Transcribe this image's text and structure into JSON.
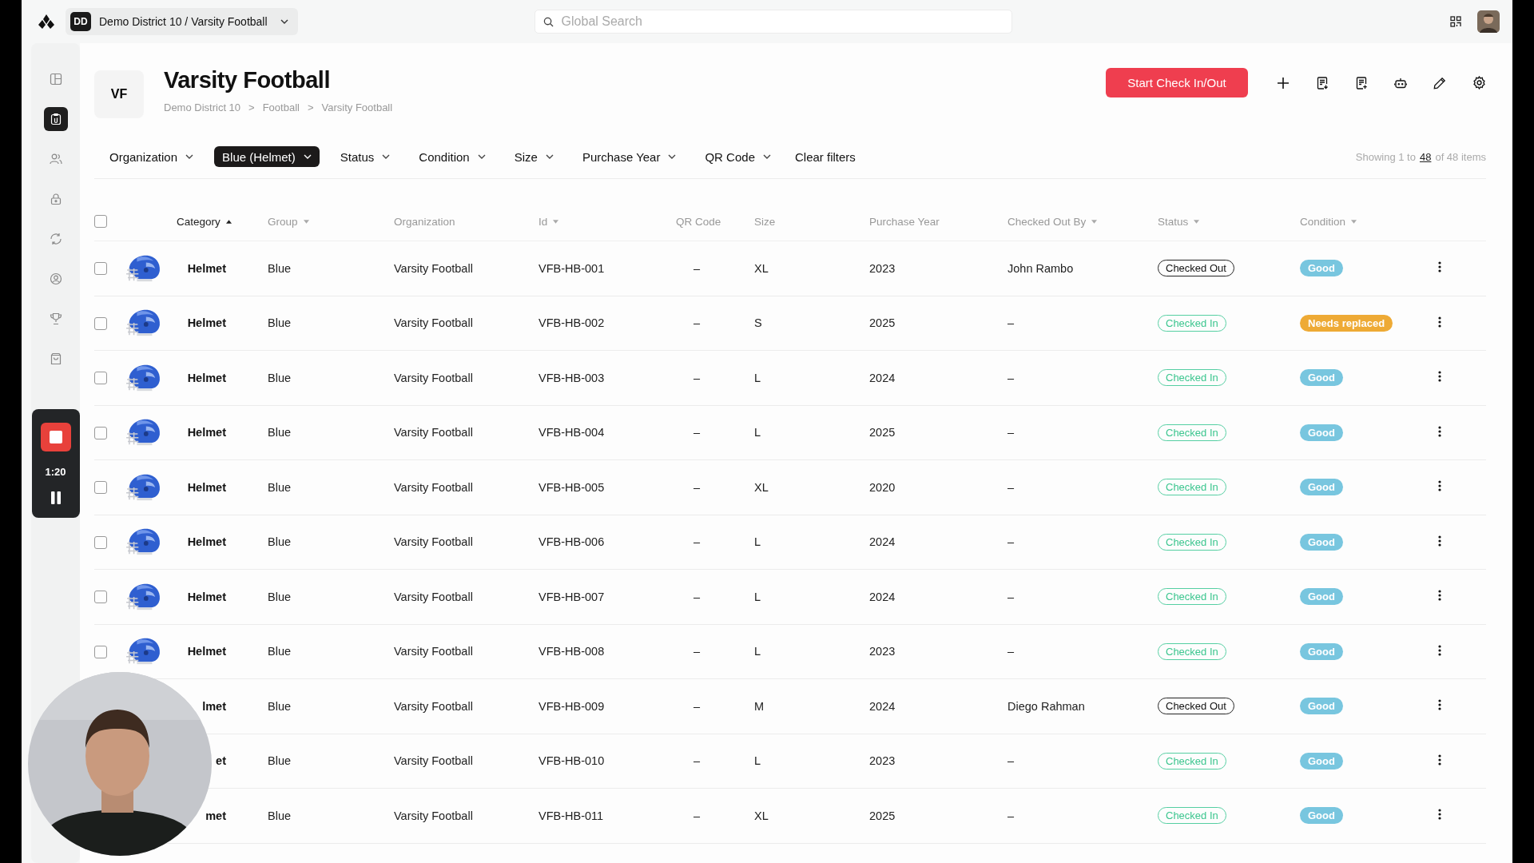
{
  "topbar": {
    "workspace_initials": "DD",
    "workspace": "Demo District 10 / Varsity Football",
    "search": {
      "placeholder": "Global Search"
    }
  },
  "sidebar": {
    "items": [
      {
        "selected": false
      },
      {
        "selected": true
      },
      {
        "selected": false
      },
      {
        "selected": false
      },
      {
        "selected": false
      },
      {
        "selected": false
      },
      {
        "selected": false
      },
      {
        "selected": false
      }
    ]
  },
  "recorder": {
    "time": "1:20"
  },
  "header": {
    "initials": "VF",
    "title": "Varsity Football",
    "breadcrumb": [
      "Demo District 10",
      "Football",
      "Varsity Football"
    ],
    "separator": ">",
    "primary_button": "Start Check In/Out"
  },
  "filters": [
    {
      "label": "Organization",
      "selected": false
    },
    {
      "label": "Blue (Helmet)",
      "selected": true
    },
    {
      "label": "Status",
      "selected": false
    },
    {
      "label": "Condition",
      "selected": false
    },
    {
      "label": "Size",
      "selected": false
    },
    {
      "label": "Purchase Year",
      "selected": false
    },
    {
      "label": "QR Code",
      "selected": false
    }
  ],
  "clear_filters": "Clear filters",
  "showing": {
    "prefix": "Showing 1 to",
    "page_size": "48",
    "suffix": "of 48 items"
  },
  "table": {
    "select_all_checked": false,
    "columns": [
      {
        "label": "Category",
        "sortable": true,
        "sorted": true
      },
      {
        "label": "Group",
        "sortable": true,
        "sorted": false
      },
      {
        "label": "Organization",
        "sortable": false,
        "sorted": false
      },
      {
        "label": "Id",
        "sortable": true,
        "sorted": false
      },
      {
        "label": "QR Code",
        "sortable": false,
        "sorted": false
      },
      {
        "label": "Size",
        "sortable": false,
        "sorted": false
      },
      {
        "label": "Purchase Year",
        "sortable": false,
        "sorted": false
      },
      {
        "label": "Checked Out By",
        "sortable": true,
        "sorted": false
      },
      {
        "label": "Status",
        "sortable": true,
        "sorted": false
      },
      {
        "label": "Condition",
        "sortable": true,
        "sorted": false
      }
    ],
    "rows": [
      {
        "checked": false,
        "category": "Helmet",
        "group": "Blue",
        "organization": "Varsity Football",
        "id": "VFB-HB-001",
        "qr_code": "–",
        "size": "XL",
        "purchase_year": "2023",
        "checked_out_by": "John Rambo",
        "status": {
          "kind": "checked_out",
          "label": "Checked Out"
        },
        "condition": {
          "kind": "good",
          "label": "Good"
        }
      },
      {
        "checked": false,
        "category": "Helmet",
        "group": "Blue",
        "organization": "Varsity Football",
        "id": "VFB-HB-002",
        "qr_code": "–",
        "size": "S",
        "purchase_year": "2025",
        "checked_out_by": "–",
        "status": {
          "kind": "checked_in",
          "label": "Checked In"
        },
        "condition": {
          "kind": "needs_replaced",
          "label": "Needs replaced"
        }
      },
      {
        "checked": false,
        "category": "Helmet",
        "group": "Blue",
        "organization": "Varsity Football",
        "id": "VFB-HB-003",
        "qr_code": "–",
        "size": "L",
        "purchase_year": "2024",
        "checked_out_by": "–",
        "status": {
          "kind": "checked_in",
          "label": "Checked In"
        },
        "condition": {
          "kind": "good",
          "label": "Good"
        }
      },
      {
        "checked": false,
        "category": "Helmet",
        "group": "Blue",
        "organization": "Varsity Football",
        "id": "VFB-HB-004",
        "qr_code": "–",
        "size": "L",
        "purchase_year": "2025",
        "checked_out_by": "–",
        "status": {
          "kind": "checked_in",
          "label": "Checked In"
        },
        "condition": {
          "kind": "good",
          "label": "Good"
        }
      },
      {
        "checked": false,
        "category": "Helmet",
        "group": "Blue",
        "organization": "Varsity Football",
        "id": "VFB-HB-005",
        "qr_code": "–",
        "size": "XL",
        "purchase_year": "2020",
        "checked_out_by": "–",
        "status": {
          "kind": "checked_in",
          "label": "Checked In"
        },
        "condition": {
          "kind": "good",
          "label": "Good"
        }
      },
      {
        "checked": false,
        "category": "Helmet",
        "group": "Blue",
        "organization": "Varsity Football",
        "id": "VFB-HB-006",
        "qr_code": "–",
        "size": "L",
        "purchase_year": "2024",
        "checked_out_by": "–",
        "status": {
          "kind": "checked_in",
          "label": "Checked In"
        },
        "condition": {
          "kind": "good",
          "label": "Good"
        }
      },
      {
        "checked": false,
        "category": "Helmet",
        "group": "Blue",
        "organization": "Varsity Football",
        "id": "VFB-HB-007",
        "qr_code": "–",
        "size": "L",
        "purchase_year": "2024",
        "checked_out_by": "–",
        "status": {
          "kind": "checked_in",
          "label": "Checked In"
        },
        "condition": {
          "kind": "good",
          "label": "Good"
        }
      },
      {
        "checked": false,
        "category": "Helmet",
        "group": "Blue",
        "organization": "Varsity Football",
        "id": "VFB-HB-008",
        "qr_code": "–",
        "size": "L",
        "purchase_year": "2023",
        "checked_out_by": "–",
        "status": {
          "kind": "checked_in",
          "label": "Checked In"
        },
        "condition": {
          "kind": "good",
          "label": "Good"
        }
      },
      {
        "category": "lmet",
        "group": "Blue",
        "organization": "Varsity Football",
        "id": "VFB-HB-009",
        "qr_code": "–",
        "size": "M",
        "purchase_year": "2024",
        "checked_out_by": "Diego Rahman",
        "status": {
          "kind": "checked_out",
          "label": "Checked Out"
        },
        "condition": {
          "kind": "good",
          "label": "Good"
        }
      },
      {
        "category": "et",
        "group": "Blue",
        "organization": "Varsity Football",
        "id": "VFB-HB-010",
        "qr_code": "–",
        "size": "L",
        "purchase_year": "2023",
        "checked_out_by": "–",
        "status": {
          "kind": "checked_in",
          "label": "Checked In"
        },
        "condition": {
          "kind": "good",
          "label": "Good"
        }
      },
      {
        "category": "met",
        "group": "Blue",
        "organization": "Varsity Football",
        "id": "VFB-HB-011",
        "qr_code": "–",
        "size": "XL",
        "purchase_year": "2025",
        "checked_out_by": "–",
        "status": {
          "kind": "checked_in",
          "label": "Checked In"
        },
        "condition": {
          "kind": "good",
          "label": "Good"
        }
      }
    ]
  }
}
